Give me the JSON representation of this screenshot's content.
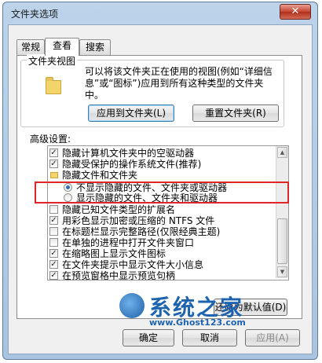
{
  "window": {
    "title": "文件夹选项",
    "close_label": "✕"
  },
  "tabs": [
    {
      "label": "常规",
      "active": false
    },
    {
      "label": "查看",
      "active": true
    },
    {
      "label": "搜索",
      "active": false
    }
  ],
  "folder_view": {
    "group_label": "文件夹视图",
    "description": "可以将该文件夹正在使用的视图(例如“详细信息”或“图标”)应用到所有这种类型的文件夹中。",
    "apply_button": "应用到文件夹(L)",
    "reset_button": "重置文件夹(R)"
  },
  "advanced": {
    "label": "高级设置:",
    "items": [
      {
        "type": "checkbox",
        "checked": true,
        "label": "隐藏计算机文件夹中的空驱动器"
      },
      {
        "type": "checkbox",
        "checked": true,
        "label": "隐藏受保护的操作系统文件(推荐)"
      },
      {
        "type": "folder",
        "label": "隐藏文件和文件夹"
      },
      {
        "type": "radio",
        "selected": true,
        "label": "不显示隐藏的文件、文件夹或驱动器"
      },
      {
        "type": "radio",
        "selected": false,
        "label": "显示隐藏的文件、文件夹和驱动器"
      },
      {
        "type": "checkbox",
        "checked": false,
        "label": "隐藏已知文件类型的扩展名"
      },
      {
        "type": "checkbox",
        "checked": true,
        "label": "用彩色显示加密或压缩的 NTFS 文件"
      },
      {
        "type": "checkbox",
        "checked": false,
        "label": "在标题栏显示完整路径(仅限经典主题)"
      },
      {
        "type": "checkbox",
        "checked": false,
        "label": "在单独的进程中打开文件夹窗口"
      },
      {
        "type": "checkbox",
        "checked": true,
        "label": "在缩略图上显示文件图标"
      },
      {
        "type": "checkbox",
        "checked": true,
        "label": "在文件夹提示中显示文件大小信息"
      },
      {
        "type": "checkbox",
        "checked": true,
        "label": "在预览窗格中显示预览句柄"
      }
    ]
  },
  "restore_defaults_button": "还原为默认值(D)",
  "footer": {
    "ok": "确定",
    "cancel": "取消",
    "apply": "应用(A)"
  },
  "watermark": {
    "title": "系统之家",
    "url": "www.Ghost123.com"
  },
  "colors": {
    "highlight_border": "#e0262d",
    "accent": "#1e63b0"
  }
}
